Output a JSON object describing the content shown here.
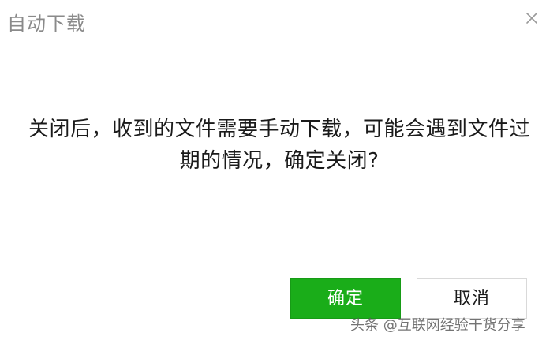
{
  "dialog": {
    "title": "自动下载",
    "message": "关闭后，收到的文件需要手动下载，可能会遇到文件过期的情况，确定关闭?",
    "confirm_label": "确定",
    "cancel_label": "取消",
    "close_icon": "close-icon"
  },
  "watermark": {
    "text": "头条 @互联网经验干货分享"
  },
  "colors": {
    "accent": "#1aad19",
    "title_text": "#8a8a8a",
    "body_text": "#1a1a1a"
  }
}
